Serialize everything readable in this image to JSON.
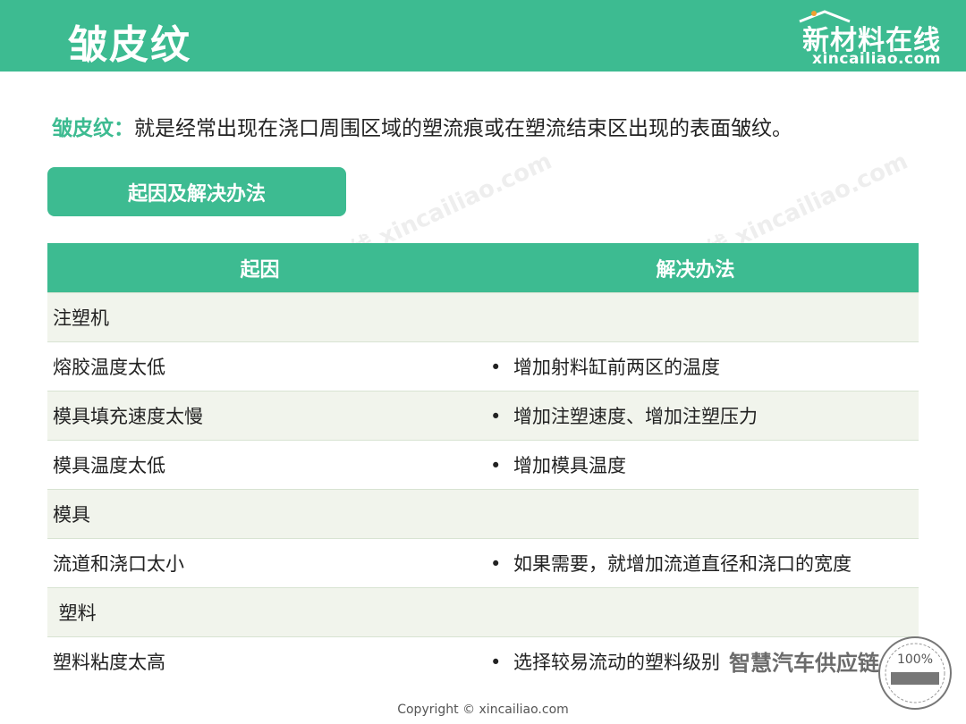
{
  "header": {
    "title": "皱皮纹"
  },
  "logo": {
    "cn": "新材料在线",
    "en": "xincailiao.com"
  },
  "intro": {
    "term": "皱皮纹：",
    "text": "就是经常出现在浇口周围区域的塑流痕或在塑流结束区出现的表面皱纹。"
  },
  "section": {
    "label": "起因及解决办法"
  },
  "table": {
    "headers": [
      "起因",
      "解决办法"
    ],
    "rows": [
      {
        "cause": "注塑机",
        "bullet": "",
        "solution": ""
      },
      {
        "cause": "熔胶温度太低",
        "bullet": "•",
        "solution": "增加射料缸前两区的温度"
      },
      {
        "cause": "模具填充速度太慢",
        "bullet": "•",
        "solution": "增加注塑速度、增加注塑压力"
      },
      {
        "cause": "模具温度太低",
        "bullet": "•",
        "solution": "增加模具温度"
      },
      {
        "cause": "模具",
        "bullet": "",
        "solution": ""
      },
      {
        "cause": "流道和浇口太小",
        "bullet": "•",
        "solution": "如果需要，就增加流道直径和浇口的宽度"
      },
      {
        "cause": " 塑料",
        "bullet": "",
        "solution": ""
      },
      {
        "cause": "塑料粘度太高",
        "bullet": "•",
        "solution": "选择较易流动的塑料级别"
      }
    ]
  },
  "watermark": {
    "text": "新材料在线",
    "url": "xincailiao.com"
  },
  "footer": {
    "copyright": "Copyright © xincailiao.com"
  },
  "overlay": {
    "text": "智慧汽车供应链",
    "stamp": "100%"
  },
  "colors": {
    "accent": "#3dbb91",
    "row_alt": "#f1f4ec"
  }
}
